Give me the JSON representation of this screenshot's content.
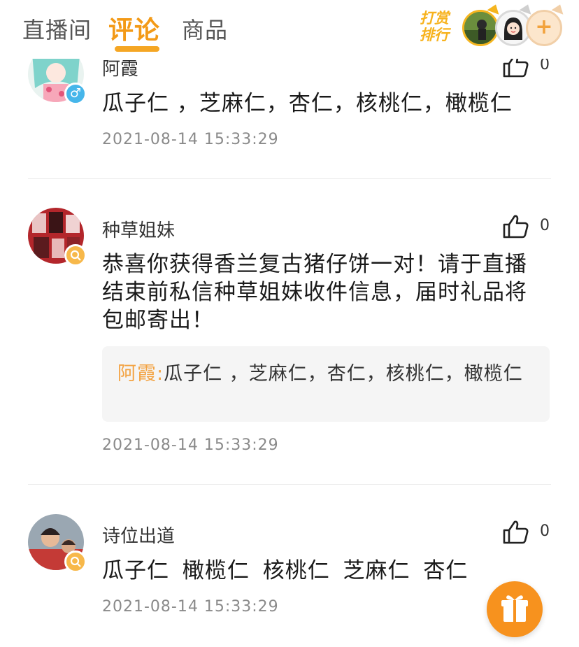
{
  "header": {
    "tabs": [
      {
        "label": "直播间",
        "active": false
      },
      {
        "label": "评论",
        "active": true
      },
      {
        "label": "商品",
        "active": false
      }
    ],
    "reward_rank_label": "打赏排行",
    "add_symbol": "+",
    "accent_color": "#f5a623"
  },
  "comments": [
    {
      "author": "阿霞",
      "gender_badge": "♂",
      "likes": "0",
      "text": "瓜子仁 ，芝麻仁，杏仁，核桃仁，橄榄仁",
      "time": "2021-08-14 15:33:29"
    },
    {
      "author": "种草姐妹",
      "likes": "0",
      "text": "恭喜你获得香兰复古猪仔饼一对！请于直播结束前私信种草姐妹收件信息，届时礼品将包邮寄出！",
      "quote": {
        "author": "阿霞:",
        "text": "瓜子仁 ，芝麻仁，杏仁，核桃仁，橄榄仁"
      },
      "time": "2021-08-14 15:33:29"
    },
    {
      "author": "诗位出道",
      "likes": "0",
      "text": "瓜子仁 橄榄仁 核桃仁 芝麻仁 杏仁",
      "time": "2021-08-14 15:33:29"
    }
  ]
}
